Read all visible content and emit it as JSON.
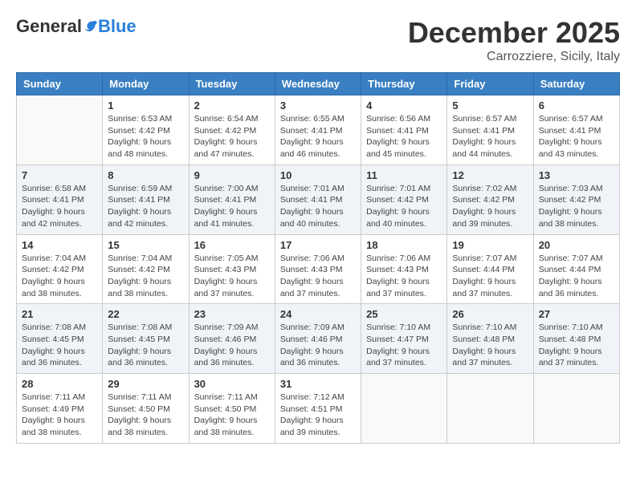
{
  "header": {
    "logo_general": "General",
    "logo_blue": "Blue",
    "month": "December 2025",
    "location": "Carrozziere, Sicily, Italy"
  },
  "weekdays": [
    "Sunday",
    "Monday",
    "Tuesday",
    "Wednesday",
    "Thursday",
    "Friday",
    "Saturday"
  ],
  "weeks": [
    [
      {
        "day": "",
        "info": ""
      },
      {
        "day": "1",
        "info": "Sunrise: 6:53 AM\nSunset: 4:42 PM\nDaylight: 9 hours\nand 48 minutes."
      },
      {
        "day": "2",
        "info": "Sunrise: 6:54 AM\nSunset: 4:42 PM\nDaylight: 9 hours\nand 47 minutes."
      },
      {
        "day": "3",
        "info": "Sunrise: 6:55 AM\nSunset: 4:41 PM\nDaylight: 9 hours\nand 46 minutes."
      },
      {
        "day": "4",
        "info": "Sunrise: 6:56 AM\nSunset: 4:41 PM\nDaylight: 9 hours\nand 45 minutes."
      },
      {
        "day": "5",
        "info": "Sunrise: 6:57 AM\nSunset: 4:41 PM\nDaylight: 9 hours\nand 44 minutes."
      },
      {
        "day": "6",
        "info": "Sunrise: 6:57 AM\nSunset: 4:41 PM\nDaylight: 9 hours\nand 43 minutes."
      }
    ],
    [
      {
        "day": "7",
        "info": "Sunrise: 6:58 AM\nSunset: 4:41 PM\nDaylight: 9 hours\nand 42 minutes."
      },
      {
        "day": "8",
        "info": "Sunrise: 6:59 AM\nSunset: 4:41 PM\nDaylight: 9 hours\nand 42 minutes."
      },
      {
        "day": "9",
        "info": "Sunrise: 7:00 AM\nSunset: 4:41 PM\nDaylight: 9 hours\nand 41 minutes."
      },
      {
        "day": "10",
        "info": "Sunrise: 7:01 AM\nSunset: 4:41 PM\nDaylight: 9 hours\nand 40 minutes."
      },
      {
        "day": "11",
        "info": "Sunrise: 7:01 AM\nSunset: 4:42 PM\nDaylight: 9 hours\nand 40 minutes."
      },
      {
        "day": "12",
        "info": "Sunrise: 7:02 AM\nSunset: 4:42 PM\nDaylight: 9 hours\nand 39 minutes."
      },
      {
        "day": "13",
        "info": "Sunrise: 7:03 AM\nSunset: 4:42 PM\nDaylight: 9 hours\nand 38 minutes."
      }
    ],
    [
      {
        "day": "14",
        "info": "Sunrise: 7:04 AM\nSunset: 4:42 PM\nDaylight: 9 hours\nand 38 minutes."
      },
      {
        "day": "15",
        "info": "Sunrise: 7:04 AM\nSunset: 4:42 PM\nDaylight: 9 hours\nand 38 minutes."
      },
      {
        "day": "16",
        "info": "Sunrise: 7:05 AM\nSunset: 4:43 PM\nDaylight: 9 hours\nand 37 minutes."
      },
      {
        "day": "17",
        "info": "Sunrise: 7:06 AM\nSunset: 4:43 PM\nDaylight: 9 hours\nand 37 minutes."
      },
      {
        "day": "18",
        "info": "Sunrise: 7:06 AM\nSunset: 4:43 PM\nDaylight: 9 hours\nand 37 minutes."
      },
      {
        "day": "19",
        "info": "Sunrise: 7:07 AM\nSunset: 4:44 PM\nDaylight: 9 hours\nand 37 minutes."
      },
      {
        "day": "20",
        "info": "Sunrise: 7:07 AM\nSunset: 4:44 PM\nDaylight: 9 hours\nand 36 minutes."
      }
    ],
    [
      {
        "day": "21",
        "info": "Sunrise: 7:08 AM\nSunset: 4:45 PM\nDaylight: 9 hours\nand 36 minutes."
      },
      {
        "day": "22",
        "info": "Sunrise: 7:08 AM\nSunset: 4:45 PM\nDaylight: 9 hours\nand 36 minutes."
      },
      {
        "day": "23",
        "info": "Sunrise: 7:09 AM\nSunset: 4:46 PM\nDaylight: 9 hours\nand 36 minutes."
      },
      {
        "day": "24",
        "info": "Sunrise: 7:09 AM\nSunset: 4:46 PM\nDaylight: 9 hours\nand 36 minutes."
      },
      {
        "day": "25",
        "info": "Sunrise: 7:10 AM\nSunset: 4:47 PM\nDaylight: 9 hours\nand 37 minutes."
      },
      {
        "day": "26",
        "info": "Sunrise: 7:10 AM\nSunset: 4:48 PM\nDaylight: 9 hours\nand 37 minutes."
      },
      {
        "day": "27",
        "info": "Sunrise: 7:10 AM\nSunset: 4:48 PM\nDaylight: 9 hours\nand 37 minutes."
      }
    ],
    [
      {
        "day": "28",
        "info": "Sunrise: 7:11 AM\nSunset: 4:49 PM\nDaylight: 9 hours\nand 38 minutes."
      },
      {
        "day": "29",
        "info": "Sunrise: 7:11 AM\nSunset: 4:50 PM\nDaylight: 9 hours\nand 38 minutes."
      },
      {
        "day": "30",
        "info": "Sunrise: 7:11 AM\nSunset: 4:50 PM\nDaylight: 9 hours\nand 38 minutes."
      },
      {
        "day": "31",
        "info": "Sunrise: 7:12 AM\nSunset: 4:51 PM\nDaylight: 9 hours\nand 39 minutes."
      },
      {
        "day": "",
        "info": ""
      },
      {
        "day": "",
        "info": ""
      },
      {
        "day": "",
        "info": ""
      }
    ]
  ]
}
